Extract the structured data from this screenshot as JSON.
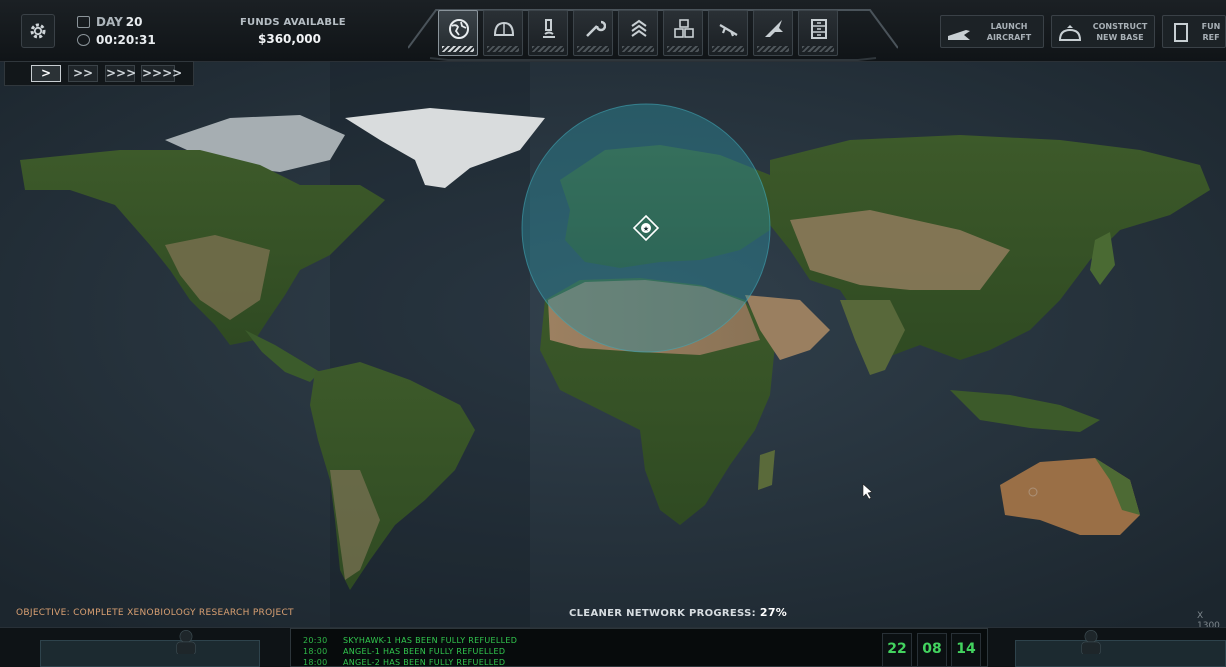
{
  "hud": {
    "day_label": "DAY",
    "day_value": "20",
    "time": "00:20:31",
    "funds_label": "FUNDS AVAILABLE",
    "funds_value": "$360,000"
  },
  "nav": [
    {
      "name": "geoscape",
      "icon": "globe-icon",
      "active": true
    },
    {
      "name": "base",
      "icon": "dome-icon",
      "active": false
    },
    {
      "name": "research",
      "icon": "microscope-icon",
      "active": false
    },
    {
      "name": "engineering",
      "icon": "wrench-icon",
      "active": false
    },
    {
      "name": "soldiers",
      "icon": "chevron-rank-icon",
      "active": false
    },
    {
      "name": "stores",
      "icon": "crates-icon",
      "active": false
    },
    {
      "name": "weapons",
      "icon": "rifle-icon",
      "active": false
    },
    {
      "name": "aircraft",
      "icon": "jet-icon",
      "active": false
    },
    {
      "name": "archive",
      "icon": "cabinet-icon",
      "active": false
    }
  ],
  "right_buttons": [
    {
      "line1": "LAUNCH",
      "line2": "AIRCRAFT",
      "icon": "plane-icon"
    },
    {
      "line1": "CONSTRUCT",
      "line2": "NEW BASE",
      "icon": "base-icon"
    },
    {
      "line1": "FUN",
      "line2": "REF",
      "icon": "document-icon"
    }
  ],
  "speed": [
    ">",
    ">>",
    ">>>",
    ">>>>"
  ],
  "objective": "OBJECTIVE: COMPLETE XENOBIOLOGY RESEARCH PROJECT",
  "progress": {
    "label": "CLEANER NETWORK PROGRESS:",
    "value": "27%"
  },
  "coord": "X 1300",
  "log": [
    {
      "time": "20:30",
      "text": "SKYHAWK-1 HAS BEEN FULLY REFUELLED"
    },
    {
      "time": "18:00",
      "text": "ANGEL-1 HAS BEEN FULLY REFUELLED"
    },
    {
      "time": "18:00",
      "text": "ANGEL-2 HAS BEEN FULLY REFUELLED"
    }
  ],
  "clock": [
    "22",
    "08",
    "14"
  ],
  "colors": {
    "accent": "#2fc04f",
    "objective": "#d9a072",
    "radar": "#2d8a9a"
  }
}
